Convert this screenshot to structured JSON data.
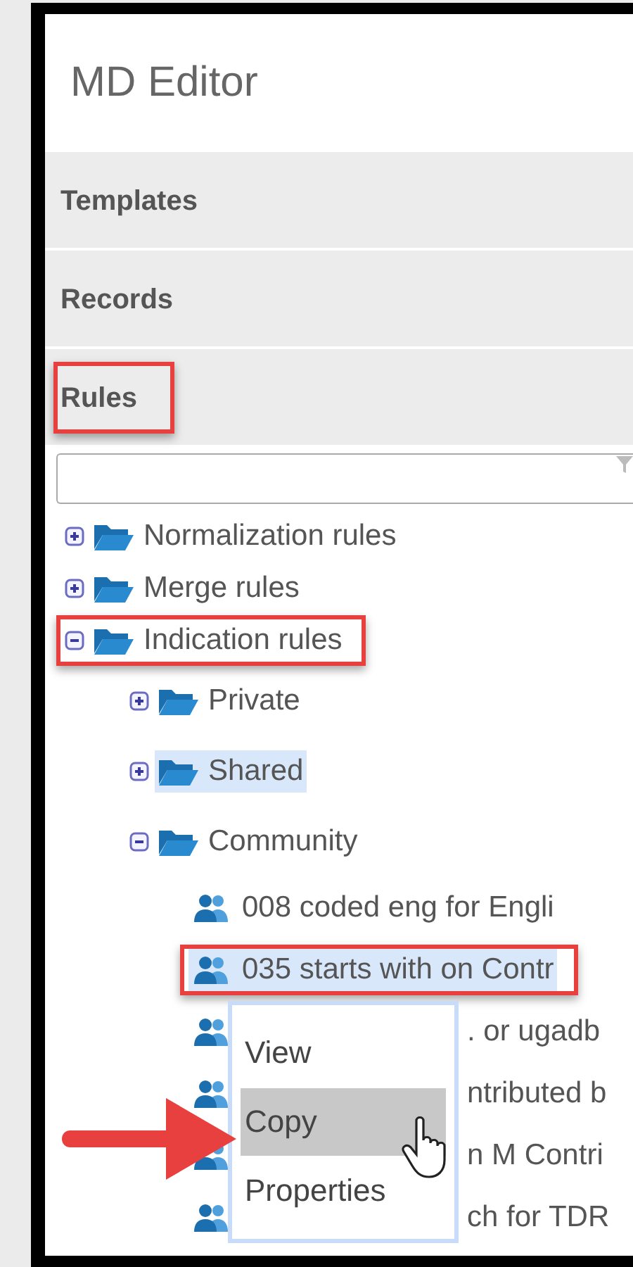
{
  "app_title": "MD Editor",
  "sections": [
    {
      "label": "Templates",
      "annotated": false
    },
    {
      "label": "Records",
      "annotated": false
    },
    {
      "label": "Rules",
      "annotated": true
    }
  ],
  "tree": [
    {
      "label": "Normalization rules",
      "kind": "folder",
      "expanded": false,
      "selected": false,
      "annotated": false
    },
    {
      "label": "Merge rules",
      "kind": "folder",
      "expanded": false,
      "selected": false,
      "annotated": false
    },
    {
      "label": "Indication rules",
      "kind": "folder",
      "expanded": true,
      "selected": false,
      "annotated": true,
      "children": [
        {
          "label": "Private",
          "kind": "folder",
          "expanded": false,
          "selected": false,
          "annotated": false
        },
        {
          "label": "Shared",
          "kind": "folder",
          "expanded": false,
          "selected": true,
          "annotated": false
        },
        {
          "label": "Community",
          "kind": "folder",
          "expanded": true,
          "selected": false,
          "annotated": false,
          "children": [
            {
              "label": "008 coded eng for Engli",
              "kind": "rule",
              "selected": false,
              "annotated": false,
              "covered": false
            },
            {
              "label": "035 starts with on Contr",
              "kind": "rule",
              "selected": true,
              "annotated": true,
              "covered": false
            },
            {
              "label": ". or ugadb",
              "kind": "rule",
              "selected": false,
              "annotated": false,
              "covered": true
            },
            {
              "label": "ntributed b",
              "kind": "rule",
              "selected": false,
              "annotated": false,
              "covered": true
            },
            {
              "label": "n M Contri",
              "kind": "rule",
              "selected": false,
              "annotated": false,
              "covered": true
            },
            {
              "label": "ch for TDR",
              "kind": "rule",
              "selected": false,
              "annotated": false,
              "covered": true
            }
          ]
        }
      ]
    }
  ],
  "context_menu": {
    "items": [
      {
        "label": "View",
        "selected": false
      },
      {
        "label": "Copy",
        "selected": true
      },
      {
        "label": "Properties",
        "selected": false
      }
    ]
  }
}
